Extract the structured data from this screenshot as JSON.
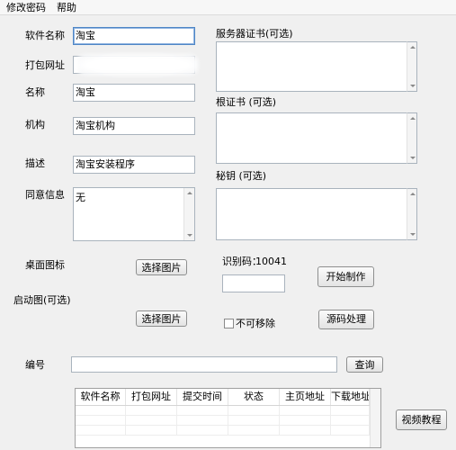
{
  "menu": {
    "items": [
      "修改密码",
      "帮助"
    ]
  },
  "form": {
    "software_name": {
      "label": "软件名称",
      "value": "淘宝"
    },
    "package_url": {
      "label": "打包网址",
      "value": ""
    },
    "name": {
      "label": "名称",
      "value": "淘宝"
    },
    "org": {
      "label": "机构",
      "value": "淘宝机构"
    },
    "desc": {
      "label": "描述",
      "value": "淘宝安装程序"
    },
    "agree": {
      "label": "同意信息",
      "value": "无"
    },
    "desktop_icon": {
      "label": "桌面图标",
      "button": "选择图片"
    },
    "splash": {
      "label": "启动图(可选)",
      "button": "选择图片"
    },
    "code": {
      "label": "编号",
      "value": "",
      "button": "查询"
    }
  },
  "certs": {
    "server_cert": {
      "label": "服务器证书(可选)",
      "value": ""
    },
    "root_cert": {
      "label": "根证书 (可选)",
      "value": ""
    },
    "key": {
      "label": "秘钥 (可选)",
      "value": ""
    }
  },
  "recognition": {
    "label": "识别码：",
    "code": "10041",
    "input_value": ""
  },
  "actions": {
    "start": "开始制作",
    "source": "源码处理",
    "not_movable": "不可移除",
    "not_movable_checked": false,
    "video": "视频教程"
  },
  "table": {
    "columns": [
      "软件名称",
      "打包网址",
      "提交时间",
      "状态",
      "主页地址",
      "下载地址"
    ],
    "rows": []
  }
}
